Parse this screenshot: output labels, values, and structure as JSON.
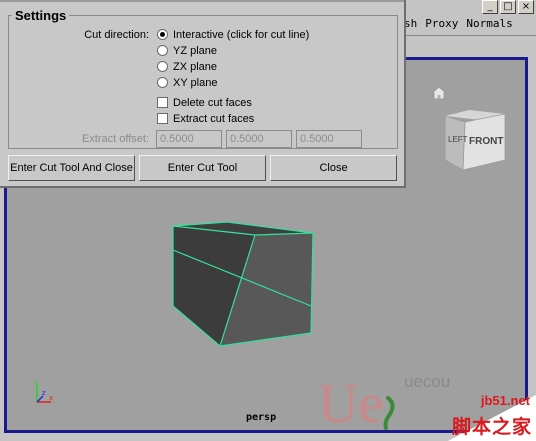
{
  "window": {
    "controls": [
      "_",
      "□",
      "×"
    ],
    "panel_menu": [
      "sh",
      "Proxy",
      "Normals"
    ]
  },
  "viewport": {
    "camera_label": "persp",
    "viewcube": {
      "left_face": "LEFT",
      "front_face": "FRONT"
    },
    "selection_color": "#33e29a",
    "border_color": "#1a1a8c"
  },
  "dialog": {
    "settings_title": "Settings",
    "cut_direction_label": "Cut direction:",
    "cut_directions": [
      {
        "label": "Interactive (click for cut line)",
        "checked": true
      },
      {
        "label": "YZ plane",
        "checked": false
      },
      {
        "label": "ZX plane",
        "checked": false
      },
      {
        "label": "XY plane",
        "checked": false
      }
    ],
    "delete_cut_faces": {
      "label": "Delete cut faces",
      "checked": false
    },
    "extract_cut_faces": {
      "label": "Extract cut faces",
      "checked": false
    },
    "extract_offset_label": "Extract offset:",
    "extract_offset_values": [
      "0.5000",
      "0.5000",
      "0.5000"
    ],
    "buttons": {
      "enter_close": "Enter Cut Tool And Close",
      "enter": "Enter Cut Tool",
      "close": "Close"
    }
  },
  "watermark": {
    "logo_text": "Ue",
    "text": "uecou",
    "domain": "jb51.net",
    "cn": "脚本之家"
  }
}
